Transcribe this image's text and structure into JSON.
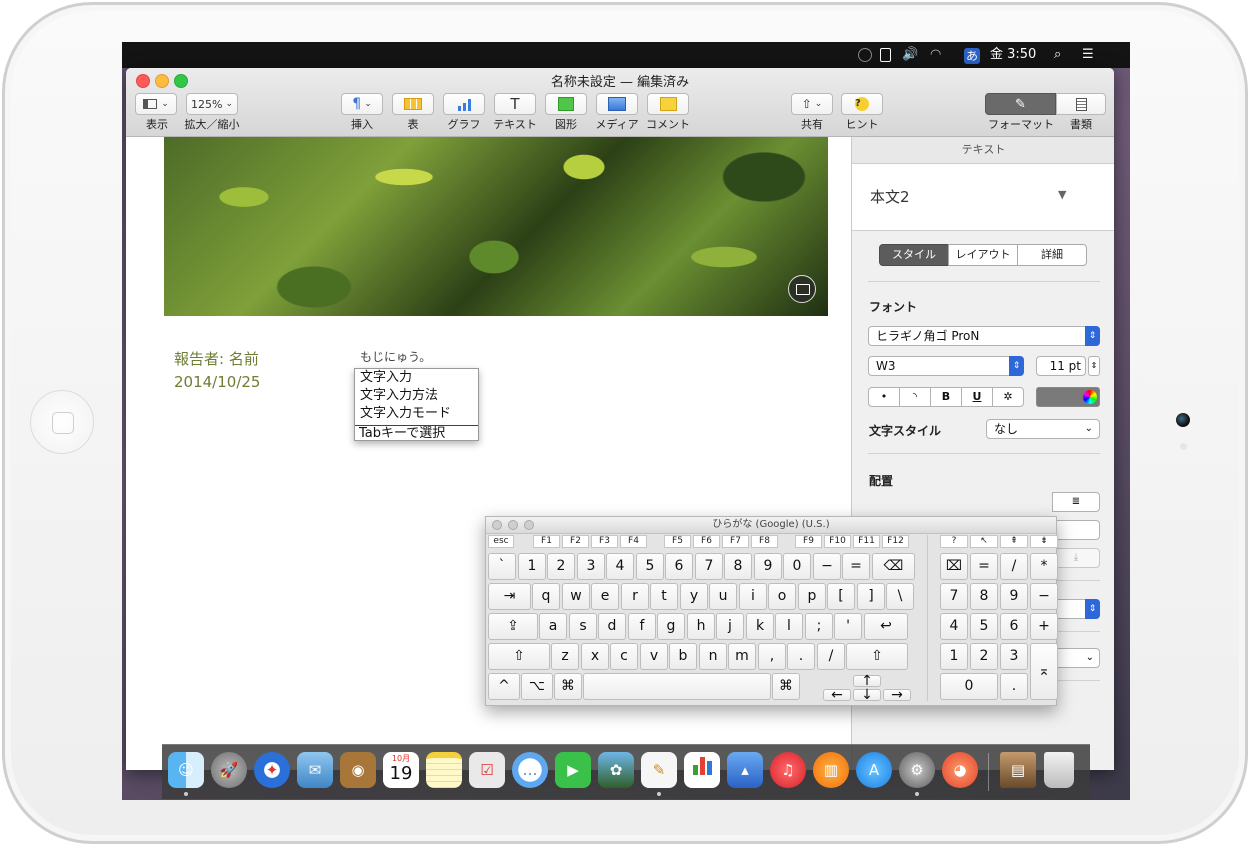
{
  "menubar": {
    "ime_char": "あ",
    "clock": "金 3:50"
  },
  "window": {
    "title": "名称未設定 — 編集済み"
  },
  "toolbar": {
    "view_label": "表示",
    "zoom_value": "125%",
    "zoom_label": "拡大／縮小",
    "insert_label": "挿入",
    "table_label": "表",
    "chart_label": "グラフ",
    "text_label": "テキスト",
    "shape_label": "図形",
    "media_label": "メディア",
    "comment_label": "コメント",
    "share_label": "共有",
    "tips_label": "ヒント",
    "tips_glyph": "?",
    "format_label": "フォーマット",
    "document_label": "書類",
    "insert_glyph": "¶",
    "text_glyph": "T"
  },
  "document": {
    "author_line": "報告者: 名前",
    "date_line": "2014/10/25",
    "ime_composition": "もじにゅう。",
    "candidates": [
      "文字入力",
      "文字入力方法",
      "文字入力モード"
    ],
    "candidate_hint": "Tabキーで選択"
  },
  "inspector": {
    "header": "テキスト",
    "paragraph_style": "本文2",
    "tabs": [
      "スタイル",
      "レイアウト",
      "詳細"
    ],
    "font_section": "フォント",
    "font_name": "ヒラギノ角ゴ ProN",
    "font_weight": "W3",
    "font_size": "11 pt",
    "style_buttons": [
      "•",
      "◝",
      "B",
      "U",
      "✲"
    ],
    "char_style_label": "文字スタイル",
    "char_style_value": "なし",
    "alignment_label": "配置"
  },
  "keyboard_viewer": {
    "title": "ひらがな (Google) (U.S.)",
    "fkeys": [
      "esc",
      "F1",
      "F2",
      "F3",
      "F4",
      "F5",
      "F6",
      "F7",
      "F8",
      "F9",
      "F10",
      "F11",
      "F12"
    ],
    "row1": [
      "`",
      "1",
      "2",
      "3",
      "4",
      "5",
      "6",
      "7",
      "8",
      "9",
      "0",
      "−",
      "=",
      "⌫"
    ],
    "row2": [
      "⇥",
      "q",
      "w",
      "e",
      "r",
      "t",
      "y",
      "u",
      "i",
      "o",
      "p",
      "[",
      "]",
      "\\"
    ],
    "row3": [
      "⇪",
      "a",
      "s",
      "d",
      "f",
      "g",
      "h",
      "j",
      "k",
      "l",
      ";",
      "'",
      "↩"
    ],
    "row4": [
      "⇧",
      "z",
      "x",
      "c",
      "v",
      "b",
      "n",
      "m",
      ",",
      ".",
      "/",
      "⇧"
    ],
    "row5": [
      "^",
      "⌥",
      "⌘",
      "",
      "⌘"
    ],
    "arrows": [
      "↑",
      "←",
      "↓",
      "→"
    ],
    "pad_top": [
      "?",
      "↖",
      "⇞",
      "⇟"
    ],
    "pad_r1": [
      "⌧",
      "=",
      "/",
      "*"
    ],
    "pad_r2": [
      "7",
      "8",
      "9",
      "−"
    ],
    "pad_r3": [
      "4",
      "5",
      "6",
      "+"
    ],
    "pad_r4": [
      "1",
      "2",
      "3",
      "⌅"
    ],
    "pad_r5": [
      "0",
      "."
    ]
  },
  "dock": {
    "calendar_month": "10月",
    "calendar_day": "19"
  },
  "colors": {
    "author_text": "#6d7e34",
    "accent_blue": "#2e68d8",
    "candidate_divider": "#7a2a2a"
  }
}
